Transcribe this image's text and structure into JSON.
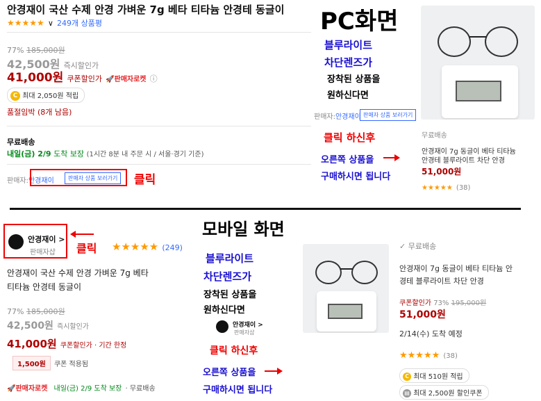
{
  "pc": {
    "heading": "PC화면",
    "title": "안경재이 국산 수제 안경 가벼운 7g 베타 티타늄 안경테 동글이",
    "stars": "★★★★★",
    "review_link": "249개 상품평",
    "discount_pct": "77%",
    "original_price": "185,000원",
    "instant_price": "42,500원",
    "instant_label": "즉시할인가",
    "coupon_price": "41,000원",
    "coupon_label": "쿠폰할인가",
    "rocket_label": "판매자로켓",
    "points": "최대 2,050원 적립",
    "soldout": "품절임박 (8개 남음)",
    "shipping_title": "무료배송",
    "delivery_date": "내일(금) 2/9",
    "delivery_guarantee": "도착 보장",
    "delivery_condition": "(1시간 8분  내 주문 시 / 서울·경기 기준)",
    "seller_label": "판매자:",
    "seller_name": "안경재이",
    "seller_button": "판매자 상품 보러가기",
    "click": "클릭",
    "annot_blue_1": "블루라이트",
    "annot_blue_2": "차단렌즈가",
    "annot_black_1": "장착된 상품을",
    "annot_black_2": "원하신다면",
    "seller_mini_label": "판매자:",
    "seller_mini_name": "안경재이",
    "seller_mini_button": "판매자 상품 보러가기",
    "after_click": "클릭 하신후",
    "right_product_1": "오른쪽 상품을",
    "right_product_2": "구매하시면 됩니다",
    "card": {
      "shipping": "무료배송",
      "name_1": "안경재이 7g 동글이 베타 티타늄",
      "name_2": "안경테 블루라이트 차단 안경",
      "price": "51,000원",
      "stars": "★★★★★",
      "reviews": "(38)"
    }
  },
  "mobile": {
    "heading": "모바일 화면",
    "seller_name": "안경재이 >",
    "seller_sub": "판매자샵",
    "click": "클릭",
    "stars": "★★★★★",
    "reviews": "(249)",
    "title_1": "안경재이 국산 수제 안경 가벼운 7g 베타",
    "title_2": "티타늄 안경테 동글이",
    "discount_pct": "77%",
    "original_price": "185,000원",
    "instant_price": "42,500원",
    "instant_label": "즉시할인가",
    "coupon_price": "41,000원",
    "coupon_label": "쿠폰할인가 · 기간 한정",
    "coupon_badge": "1,500원",
    "coupon_applied": "쿠폰 적용됨",
    "rocket_label": "판매자로켓",
    "delivery": "내일(금) 2/9 도착 보장",
    "free_ship": "· 무료배송",
    "annot_blue_1": "블루라이트",
    "annot_blue_2": "차단렌즈가",
    "annot_black_1": "장착된 상품을",
    "annot_black_2": "원하신다면",
    "mini_seller": "안경재이 >",
    "mini_seller_sub": "판매자샵",
    "after_click": "클릭 하신후",
    "right_product_1": "오른쪽 상품을",
    "right_product_2": "구매하시면 됩니다",
    "card": {
      "shipping": "무료배송",
      "name_1": "안경재이 7g 동글이 베타 티타늄 안",
      "name_2": "경테 블루라이트 차단 안경",
      "coupon_label": "쿠폰할인가",
      "pct": "73%",
      "original": "195,000원",
      "price": "51,000원",
      "delivery": "2/14(수) 도착 예정",
      "stars": "★★★★★",
      "reviews": "(38)",
      "points": "최대 510원 적립",
      "coupon": "최대 2,500원 할인쿠폰"
    }
  }
}
